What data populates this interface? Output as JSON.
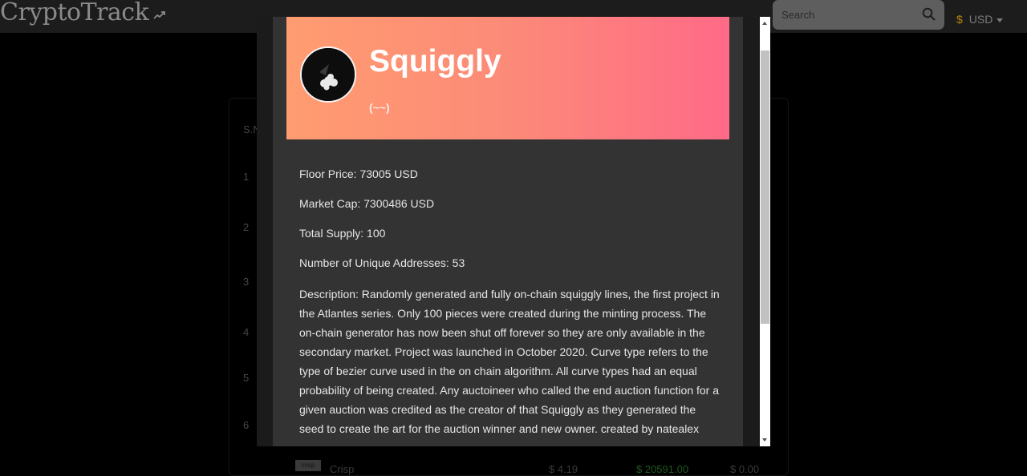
{
  "app": {
    "title": "CryptoTrack",
    "search": {
      "placeholder": "Search"
    },
    "currency": {
      "symbol": "$",
      "selected": "USD"
    }
  },
  "background_table": {
    "column_header": "S.N",
    "row_numbers": [
      "1",
      "2",
      "3",
      "4",
      "5",
      "6"
    ],
    "next_row_peek": {
      "name": "Crisp",
      "change": "$ 4.19",
      "price": "$ 20591.00",
      "volume": "$ 0.00"
    }
  },
  "modal": {
    "collection": {
      "name": "Squiggly",
      "symbol": "(~~)",
      "floor_price": "Floor Price: 73005 USD",
      "market_cap": "Market Cap: 7300486 USD",
      "total_supply": "Total Supply: 100",
      "unique_addresses": "Number of Unique Addresses: 53",
      "description": "Description: Randomly generated and fully on-chain squiggly lines, the first project in the Atlantes series. Only 100 pieces were created during the minting process. The on-chain generator has now been shut off forever so they are only available in the secondary market. Project was launched in October 2020. Curve type refers to the type of bezier curve used in the on chain algorithm. All curve types had an equal probability of being created. Any auctoineer who called the end auction function for a given auction was credited as the creator of that Squiggly as they generated the seed to create the art for the auction winner and new owner. created by natealex"
    },
    "banner_colors": [
      "#ff9c70",
      "#ff6a87"
    ]
  }
}
